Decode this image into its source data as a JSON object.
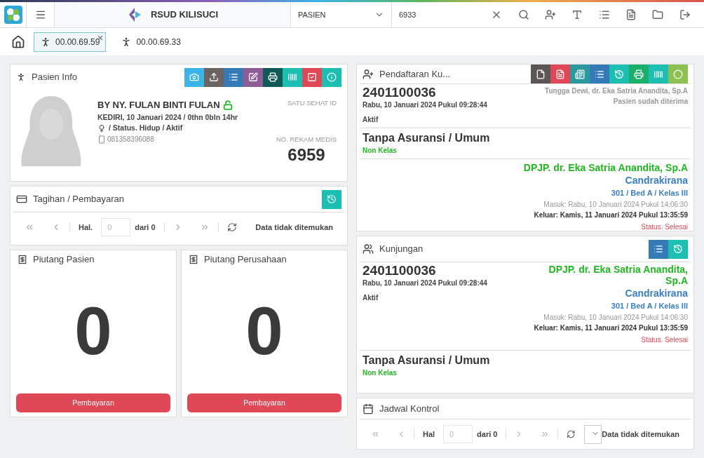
{
  "header": {
    "app_name": "RSUD KILISUCI",
    "search_type": "PASIEN",
    "search_value": "6933",
    "tools": [
      {
        "kind": "clear"
      },
      {
        "kind": "search"
      },
      {
        "kind": "add-user"
      },
      {
        "kind": "text"
      },
      {
        "kind": "list"
      },
      {
        "kind": "pdf"
      },
      {
        "kind": "folder"
      },
      {
        "kind": "logout"
      }
    ]
  },
  "patient_tabs": [
    {
      "label": "00.00.69.59",
      "selected": true,
      "closable": true
    },
    {
      "label": "00.00.69.33",
      "selected": false,
      "closable": false
    }
  ],
  "patient_info": {
    "title": "Pasien Info",
    "buttons": [
      {
        "kind": "camera",
        "color": "#3bb4e8"
      },
      {
        "kind": "upload",
        "color": "#6b6462"
      },
      {
        "kind": "list",
        "color": "#337ab7"
      },
      {
        "kind": "edit",
        "color": "#8e5d96"
      },
      {
        "kind": "print",
        "color": "#0f5a56"
      },
      {
        "kind": "barcode",
        "color": "#1ebfb3"
      },
      {
        "kind": "check",
        "color": "#e04858"
      },
      {
        "kind": "info",
        "color": "#1ebfb3"
      }
    ],
    "name": "BY NY. FULAN BINTI FULAN",
    "unlocked": true,
    "birth": "KEDIRI, 10 Januari 2024 / 0thn 0bln 14hr",
    "status": "/ Status. Hidup / Aktif",
    "phone": "081358396088",
    "satu_sehat_label": "SATU SEHAT ID",
    "rm_label": "NO. REKAM MEDIS",
    "rm_number": "6959"
  },
  "billing": {
    "title": "Tagihan / Pembayaran",
    "pager": {
      "page_label": "Hal.",
      "page_placeholder": "0",
      "total": "dari 0",
      "message": "Data tidak ditemukan"
    }
  },
  "receivables": [
    {
      "title": "Piutang Pasien",
      "amount": "0",
      "button": "Pembayaran"
    },
    {
      "title": "Piutang Perusahaan",
      "amount": "0",
      "button": "Pembayaran"
    }
  ],
  "registration": {
    "title": "Pendaftaran Ku...",
    "buttons": [
      {
        "kind": "file",
        "color": "#5c5655"
      },
      {
        "kind": "pdf",
        "color": "#e04858"
      },
      {
        "kind": "card",
        "color": "#2a9a9f"
      },
      {
        "kind": "list",
        "color": "#337ab7"
      },
      {
        "kind": "history",
        "color": "#1ebfb3"
      },
      {
        "kind": "print",
        "color": "#1aaf6a"
      },
      {
        "kind": "barcode",
        "color": "#1ebfb3"
      },
      {
        "kind": "circle",
        "color": "#8cc152"
      }
    ],
    "number": "2401100036",
    "date": "Rabu, 10 Januari 2024 Pukul 09:28:44",
    "state": "Aktif",
    "staff": "Tungga Dewi, dr. Eka Satria Anandita, Sp.A",
    "note": "Pasien sudah diterima",
    "insurance": "Tanpa Asuransi / Umum",
    "class": "Non Kelas",
    "doctor": "DPJP. dr. Eka Satria Anandita, Sp.A",
    "ward": "Candrakirana",
    "room": "301 / Bed A / Kelas III",
    "in": "Masuk: Rabu, 10 Januari 2024 Pukul 14:06:30",
    "out": "Keluar: Kamis, 11 Januari 2024 Pukul 13:35:59",
    "visit_status": "Status. Selesai"
  },
  "visit": {
    "title": "Kunjungan",
    "buttons": [
      {
        "kind": "list",
        "color": "#337ab7"
      },
      {
        "kind": "history",
        "color": "#1ebfb3"
      }
    ],
    "number": "2401100036",
    "date": "Rabu, 10 Januari 2024 Pukul 09:28:44",
    "state": "Aktif",
    "doctor": "DPJP. dr. Eka Satria Anandita, Sp.A",
    "ward": "Candrakirana",
    "room": "301 / Bed A / Kelas III",
    "in": "Masuk: Rabu, 10 Januari 2024 Pukul 14:06:30",
    "out": "Keluar: Kamis, 11 Januari 2024 Pukul 13:35:59",
    "visit_status": "Status. Selesai",
    "insurance": "Tanpa Asuransi / Umum",
    "class": "Non Kelas"
  },
  "schedule": {
    "title": "Jadwal Kontrol",
    "pager": {
      "page_label": "Hal",
      "page_placeholder": "0",
      "total": "dari 0",
      "message": "Data tidak ditemukan"
    }
  }
}
